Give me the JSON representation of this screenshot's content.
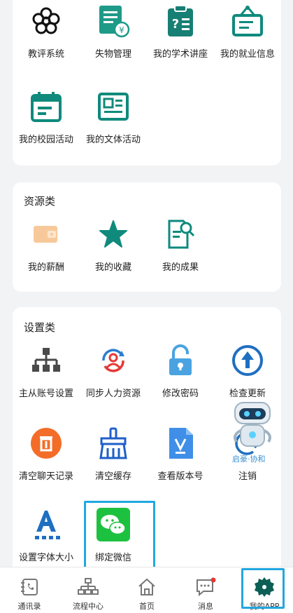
{
  "top_section": {
    "items": [
      {
        "label": "教评系统",
        "icon": "flower-icon"
      },
      {
        "label": "失物管理",
        "icon": "receipt-icon"
      },
      {
        "label": "我的学术讲座",
        "icon": "clipboard-icon"
      },
      {
        "label": "我的就业信息",
        "icon": "signboard-icon"
      },
      {
        "label": "我的校园活动",
        "icon": "calendar-icon"
      },
      {
        "label": "我的文体活动",
        "icon": "news-icon"
      }
    ]
  },
  "resource_section": {
    "title": "资源类",
    "items": [
      {
        "label": "我的薪酬",
        "icon": "wallet-icon"
      },
      {
        "label": "我的收藏",
        "icon": "star-icon"
      },
      {
        "label": "我的成果",
        "icon": "document-search-icon"
      }
    ]
  },
  "settings_section": {
    "title": "设置类",
    "items": [
      {
        "label": "主从账号设置",
        "icon": "hierarchy-icon"
      },
      {
        "label": "同步人力资源",
        "icon": "sync-user-icon"
      },
      {
        "label": "修改密码",
        "icon": "lock-icon"
      },
      {
        "label": "检查更新",
        "icon": "upload-icon"
      },
      {
        "label": "清空聊天记录",
        "icon": "trash-icon"
      },
      {
        "label": "清空缓存",
        "icon": "broom-icon"
      },
      {
        "label": "查看版本号",
        "icon": "file-v-icon"
      },
      {
        "label": "注销",
        "icon": "logout-icon"
      },
      {
        "label": "设置字体大小",
        "icon": "font-size-icon"
      },
      {
        "label": "绑定微信",
        "icon": "wechat-icon"
      }
    ]
  },
  "assistant": {
    "caption": "启豪·协和"
  },
  "tabbar": {
    "tabs": [
      {
        "label": "通讯录",
        "icon": "contacts-icon"
      },
      {
        "label": "流程中心",
        "icon": "flow-icon"
      },
      {
        "label": "首页",
        "icon": "home-icon"
      },
      {
        "label": "消息",
        "icon": "message-icon"
      },
      {
        "label": "我的APP",
        "icon": "gear-icon",
        "active": true
      }
    ]
  },
  "colors": {
    "teal": "#0f8a7c",
    "highlight": "#22a7e0",
    "wechat": "#1dc140"
  }
}
